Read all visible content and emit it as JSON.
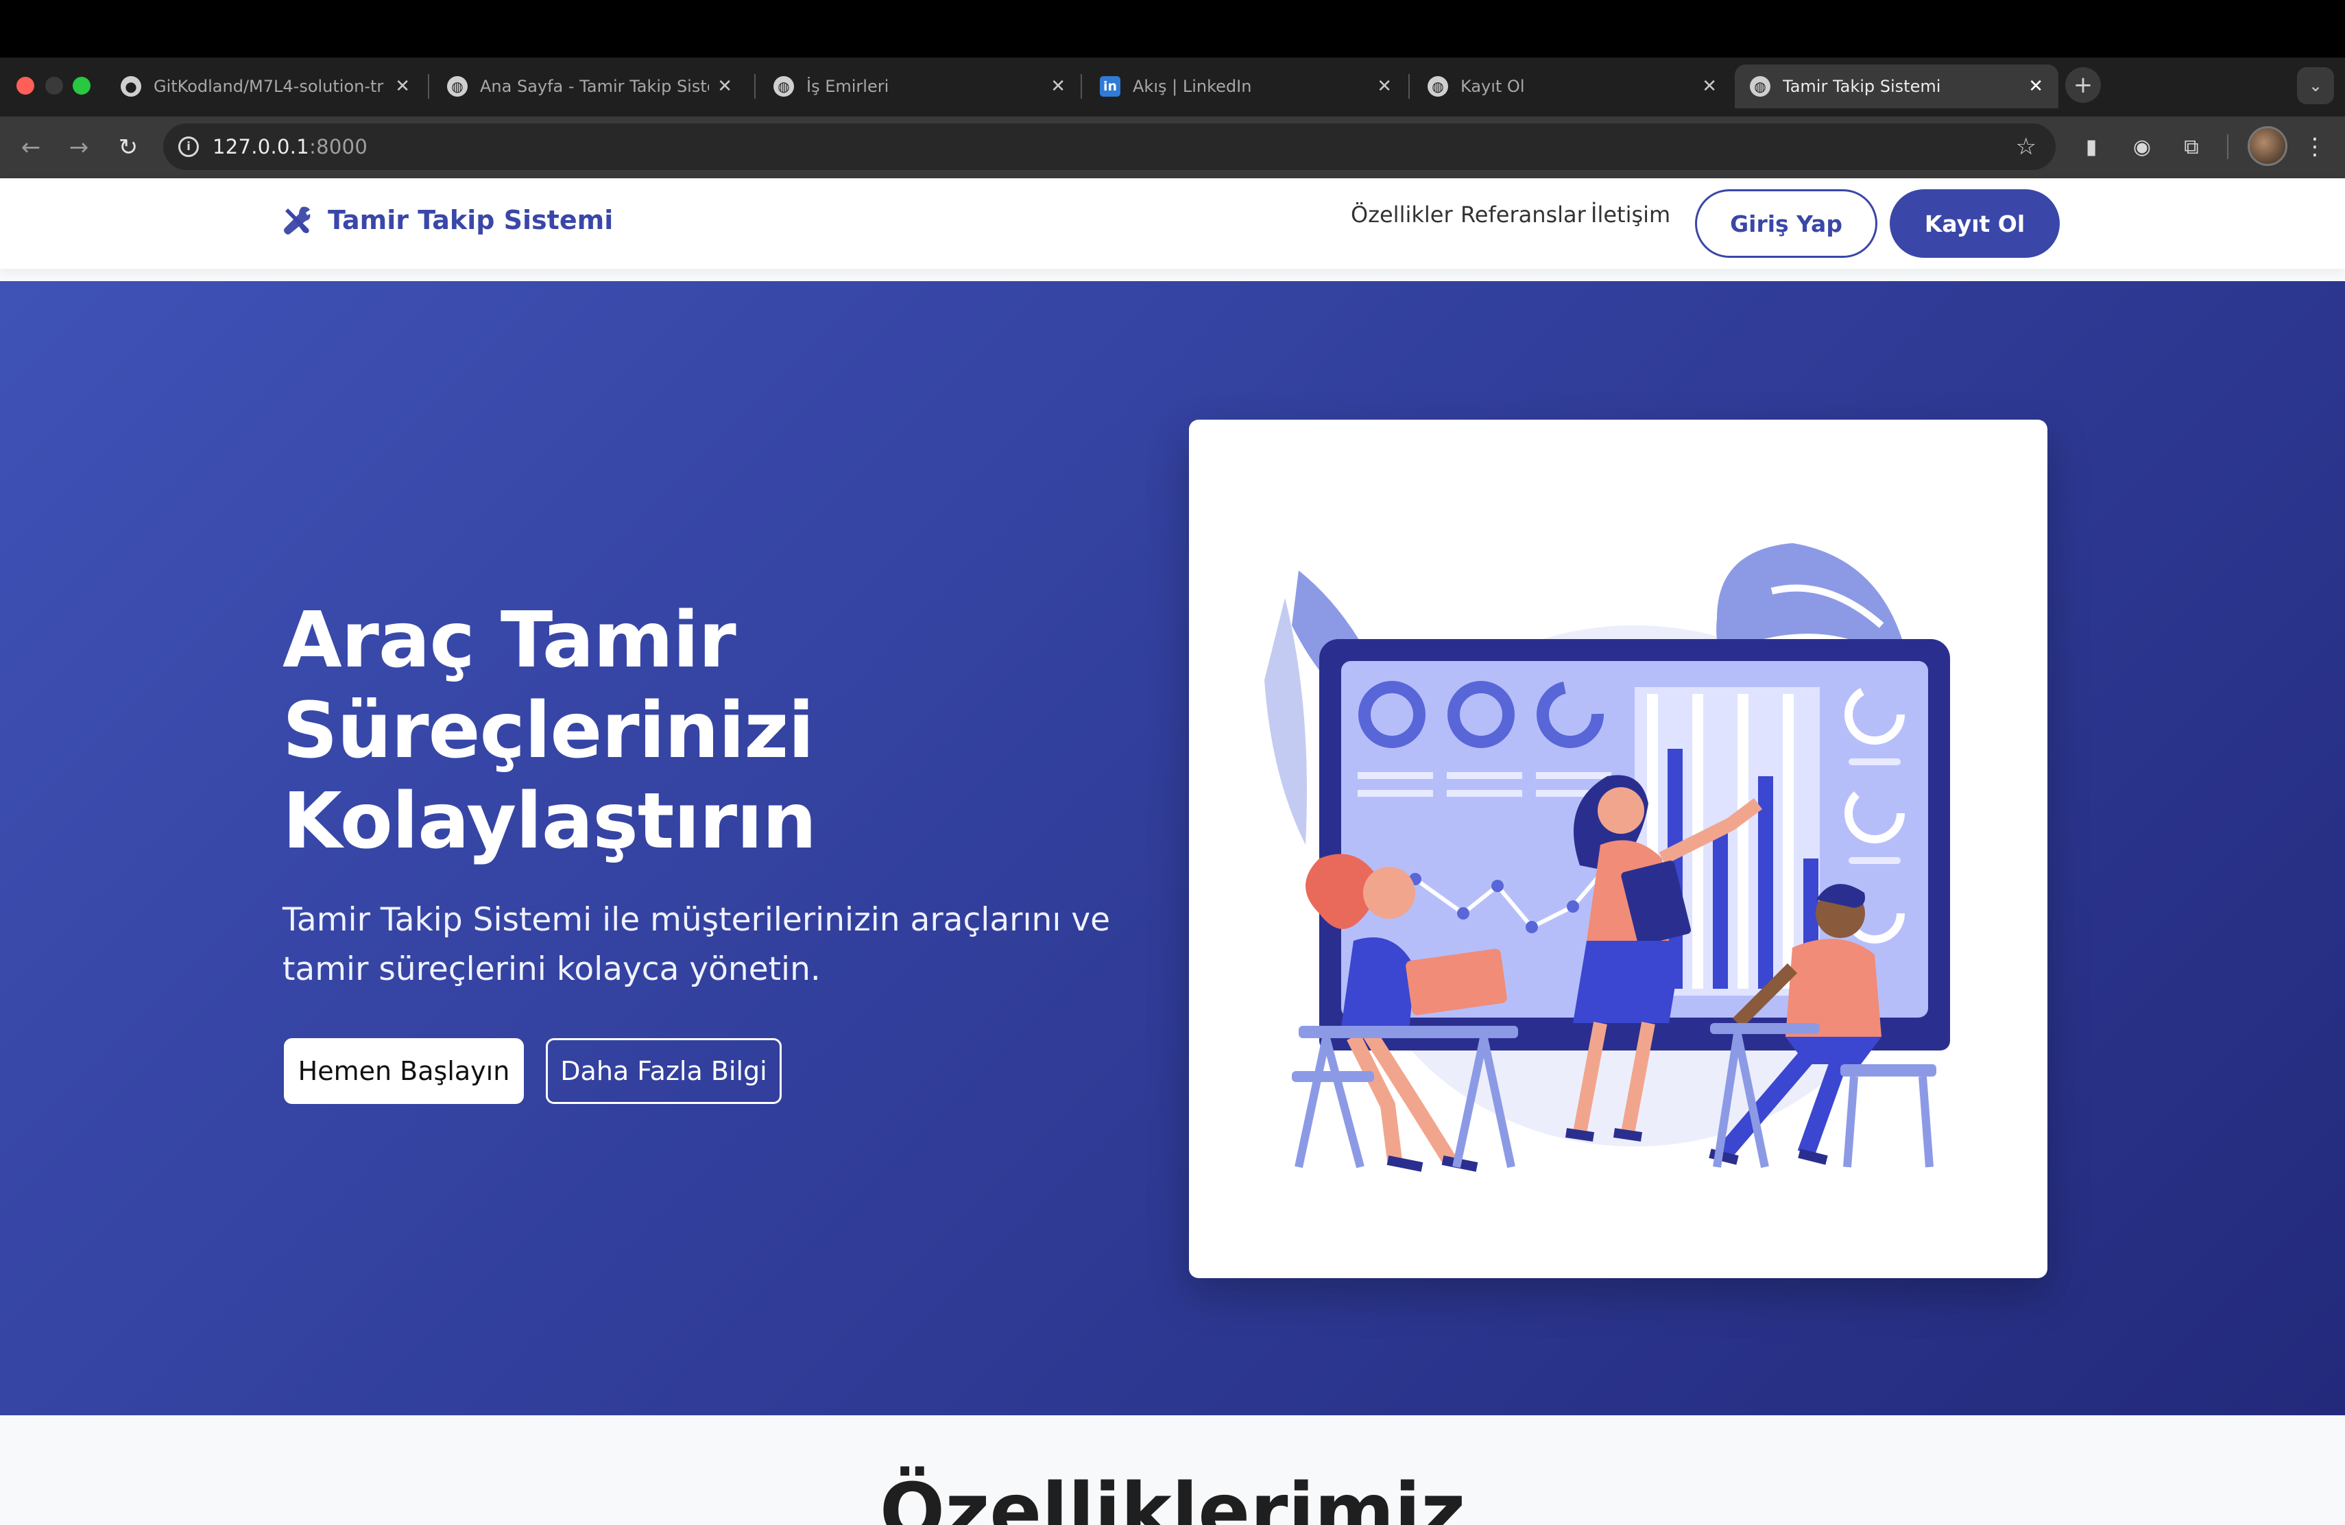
{
  "browser": {
    "tabs": [
      {
        "title": "GitKodland/M7L4-solution-tr",
        "icon": "github-icon"
      },
      {
        "title": "Ana Sayfa - Tamir Takip Siste",
        "icon": "globe-icon"
      },
      {
        "title": "İş Emirleri",
        "icon": "globe-icon"
      },
      {
        "title": "Akış | LinkedIn",
        "icon": "linkedin-icon"
      },
      {
        "title": "Kayıt Ol",
        "icon": "globe-icon"
      },
      {
        "title": "Tamir Takip Sistemi",
        "icon": "globe-icon",
        "active": true
      }
    ],
    "url_host": "127.0.0.1",
    "url_port": ":8000"
  },
  "header": {
    "brand": "Tamir Takip Sistemi",
    "nav": [
      "Özellikler",
      "Referanslar",
      "İletişim"
    ],
    "login": "Giriş Yap",
    "register": "Kayıt Ol"
  },
  "hero": {
    "title_lines": [
      "Araç Tamir",
      "Süreçlerinizi",
      "Kolaylaştırın"
    ],
    "subtitle": "Tamir Takip Sistemi ile müşterilerinizin araçlarını ve tamir süreçlerini kolayca yönetin.",
    "primary_button": "Hemen Başlayın",
    "secondary_button": "Daha Fazla Bilgi"
  },
  "features": {
    "title": "Özelliklerimiz"
  },
  "colors": {
    "brand": "#3a47a8",
    "hero_start": "#3f52b6",
    "hero_end": "#232a7c"
  }
}
